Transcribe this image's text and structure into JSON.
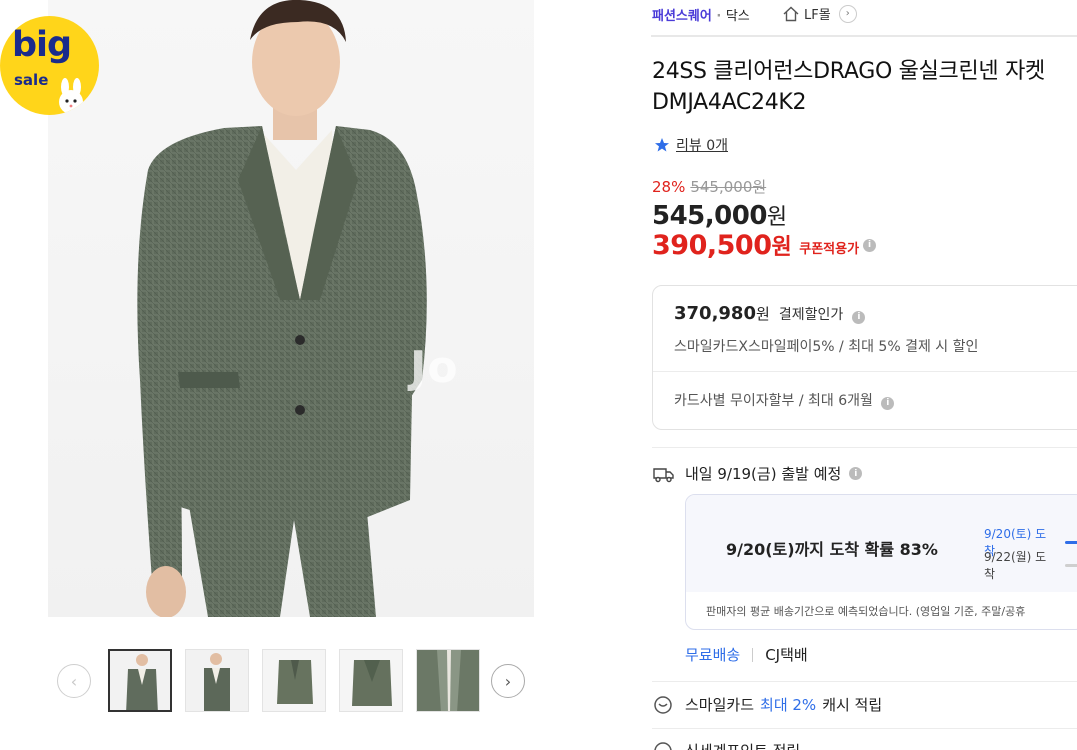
{
  "promo_badge": {
    "big": "big",
    "sale": "sale"
  },
  "main_image": {
    "watermark": "Jo"
  },
  "thumbnails": {
    "count": 5,
    "active_index": 0
  },
  "breadcrumb": {
    "brand": "패션스퀘어",
    "dot": "·",
    "brand_sub": "닥스",
    "store": "LF몰"
  },
  "product": {
    "title": "24SS 클리어런스DRAGO 울실크린넨 자켓 DMJA4AC24K2",
    "review_label": "리뷰 0개"
  },
  "price": {
    "discount_rate": "28%",
    "original": "545,000원",
    "sale_amount": "545,000",
    "coupon_amount": "390,500",
    "won": "원",
    "coupon_label": "쿠폰적용가"
  },
  "benefit": {
    "pay_amount": "370,980",
    "won": "원",
    "pay_label": "결제할인가",
    "pay_desc": "스마일카드X스마일페이5% / 최대 5% 결제 시 할인",
    "installment": "카드사별 무이자할부 / 최대 6개월"
  },
  "shipping": {
    "departure": "내일 9/19(금) 출발 예정",
    "arrival_prob": "9/20(토)까지 도착 확률 83%",
    "row1": "9/20(토) 도착",
    "row2": "9/22(월) 도착",
    "note": "판매자의 평균 배송기간으로 예측되었습니다. (영업일 기준, 주말/공휴",
    "free": "무료배송",
    "courier": "CJ택배"
  },
  "cashback": {
    "prefix": "스마일카드",
    "accent": "최대 2%",
    "suffix": "캐시 적립"
  },
  "more": {
    "label": "신세계포인트 적립"
  },
  "colors": {
    "accent_blue": "#2f6ee8",
    "price_red": "#e0231d",
    "brand_purple": "#4a3bd8",
    "badge_yellow": "#ffd51a"
  },
  "icons": [
    "home-icon",
    "chevron-right-icon",
    "star-icon",
    "info-icon",
    "truck-icon",
    "coin-icon",
    "chevron-left-icon"
  ]
}
